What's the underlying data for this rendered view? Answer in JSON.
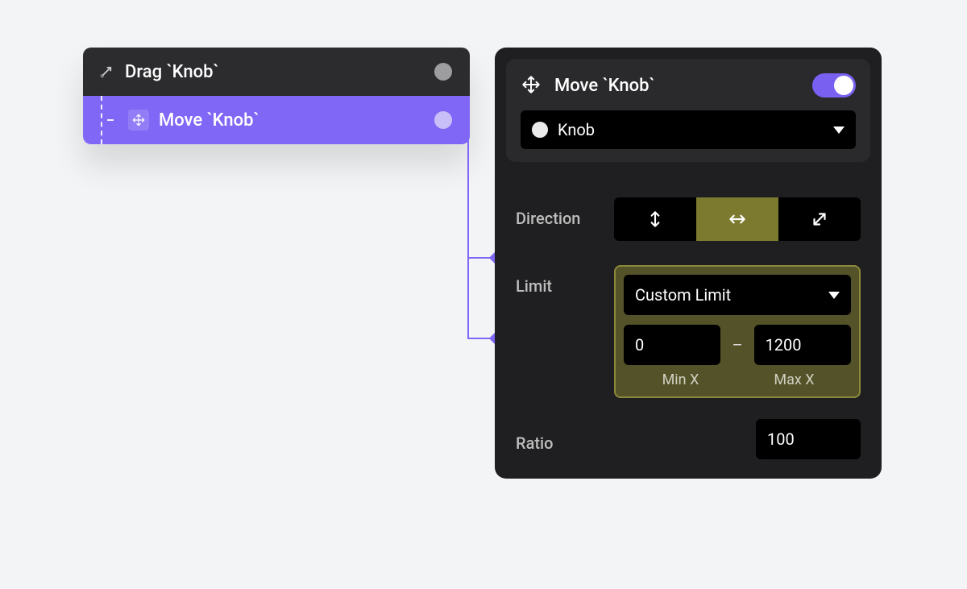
{
  "nodeList": {
    "drag": {
      "label": "Drag `Knob`"
    },
    "move": {
      "label": "Move `Knob`"
    }
  },
  "inspector": {
    "title": "Move `Knob`",
    "target": "Knob",
    "direction": {
      "label": "Direction",
      "selected": "horizontal"
    },
    "limit": {
      "label": "Limit",
      "mode": "Custom Limit",
      "min": "0",
      "max": "1200",
      "minLabel": "Min X",
      "maxLabel": "Max X"
    },
    "ratio": {
      "label": "Ratio",
      "value": "100"
    }
  },
  "colors": {
    "accent": "#8167f5",
    "olive": "#7b7a2f",
    "panel": "#1f1f21"
  }
}
